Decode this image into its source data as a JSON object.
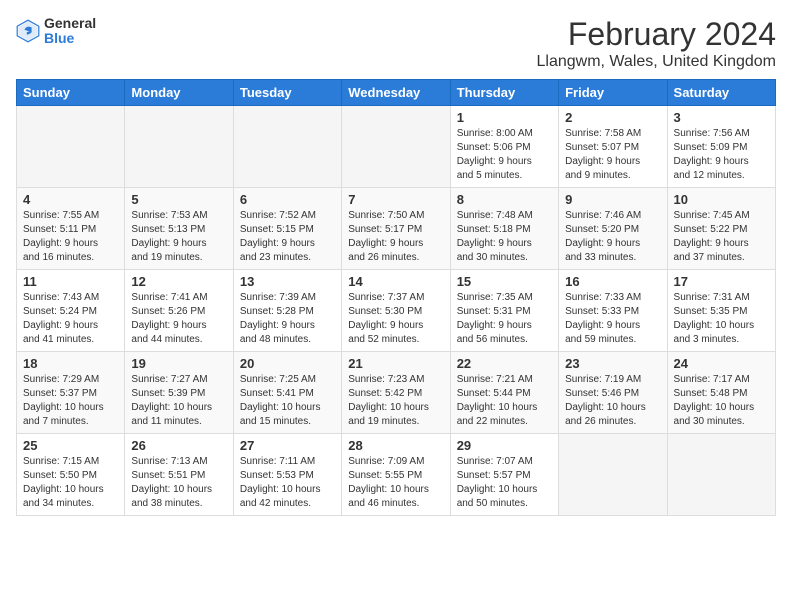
{
  "header": {
    "logo_general": "General",
    "logo_blue": "Blue",
    "title": "February 2024",
    "subtitle": "Llangwm, Wales, United Kingdom"
  },
  "days_of_week": [
    "Sunday",
    "Monday",
    "Tuesday",
    "Wednesday",
    "Thursday",
    "Friday",
    "Saturday"
  ],
  "weeks": [
    [
      {
        "day": "",
        "info": ""
      },
      {
        "day": "",
        "info": ""
      },
      {
        "day": "",
        "info": ""
      },
      {
        "day": "",
        "info": ""
      },
      {
        "day": "1",
        "info": "Sunrise: 8:00 AM\nSunset: 5:06 PM\nDaylight: 9 hours\nand 5 minutes."
      },
      {
        "day": "2",
        "info": "Sunrise: 7:58 AM\nSunset: 5:07 PM\nDaylight: 9 hours\nand 9 minutes."
      },
      {
        "day": "3",
        "info": "Sunrise: 7:56 AM\nSunset: 5:09 PM\nDaylight: 9 hours\nand 12 minutes."
      }
    ],
    [
      {
        "day": "4",
        "info": "Sunrise: 7:55 AM\nSunset: 5:11 PM\nDaylight: 9 hours\nand 16 minutes."
      },
      {
        "day": "5",
        "info": "Sunrise: 7:53 AM\nSunset: 5:13 PM\nDaylight: 9 hours\nand 19 minutes."
      },
      {
        "day": "6",
        "info": "Sunrise: 7:52 AM\nSunset: 5:15 PM\nDaylight: 9 hours\nand 23 minutes."
      },
      {
        "day": "7",
        "info": "Sunrise: 7:50 AM\nSunset: 5:17 PM\nDaylight: 9 hours\nand 26 minutes."
      },
      {
        "day": "8",
        "info": "Sunrise: 7:48 AM\nSunset: 5:18 PM\nDaylight: 9 hours\nand 30 minutes."
      },
      {
        "day": "9",
        "info": "Sunrise: 7:46 AM\nSunset: 5:20 PM\nDaylight: 9 hours\nand 33 minutes."
      },
      {
        "day": "10",
        "info": "Sunrise: 7:45 AM\nSunset: 5:22 PM\nDaylight: 9 hours\nand 37 minutes."
      }
    ],
    [
      {
        "day": "11",
        "info": "Sunrise: 7:43 AM\nSunset: 5:24 PM\nDaylight: 9 hours\nand 41 minutes."
      },
      {
        "day": "12",
        "info": "Sunrise: 7:41 AM\nSunset: 5:26 PM\nDaylight: 9 hours\nand 44 minutes."
      },
      {
        "day": "13",
        "info": "Sunrise: 7:39 AM\nSunset: 5:28 PM\nDaylight: 9 hours\nand 48 minutes."
      },
      {
        "day": "14",
        "info": "Sunrise: 7:37 AM\nSunset: 5:30 PM\nDaylight: 9 hours\nand 52 minutes."
      },
      {
        "day": "15",
        "info": "Sunrise: 7:35 AM\nSunset: 5:31 PM\nDaylight: 9 hours\nand 56 minutes."
      },
      {
        "day": "16",
        "info": "Sunrise: 7:33 AM\nSunset: 5:33 PM\nDaylight: 9 hours\nand 59 minutes."
      },
      {
        "day": "17",
        "info": "Sunrise: 7:31 AM\nSunset: 5:35 PM\nDaylight: 10 hours\nand 3 minutes."
      }
    ],
    [
      {
        "day": "18",
        "info": "Sunrise: 7:29 AM\nSunset: 5:37 PM\nDaylight: 10 hours\nand 7 minutes."
      },
      {
        "day": "19",
        "info": "Sunrise: 7:27 AM\nSunset: 5:39 PM\nDaylight: 10 hours\nand 11 minutes."
      },
      {
        "day": "20",
        "info": "Sunrise: 7:25 AM\nSunset: 5:41 PM\nDaylight: 10 hours\nand 15 minutes."
      },
      {
        "day": "21",
        "info": "Sunrise: 7:23 AM\nSunset: 5:42 PM\nDaylight: 10 hours\nand 19 minutes."
      },
      {
        "day": "22",
        "info": "Sunrise: 7:21 AM\nSunset: 5:44 PM\nDaylight: 10 hours\nand 22 minutes."
      },
      {
        "day": "23",
        "info": "Sunrise: 7:19 AM\nSunset: 5:46 PM\nDaylight: 10 hours\nand 26 minutes."
      },
      {
        "day": "24",
        "info": "Sunrise: 7:17 AM\nSunset: 5:48 PM\nDaylight: 10 hours\nand 30 minutes."
      }
    ],
    [
      {
        "day": "25",
        "info": "Sunrise: 7:15 AM\nSunset: 5:50 PM\nDaylight: 10 hours\nand 34 minutes."
      },
      {
        "day": "26",
        "info": "Sunrise: 7:13 AM\nSunset: 5:51 PM\nDaylight: 10 hours\nand 38 minutes."
      },
      {
        "day": "27",
        "info": "Sunrise: 7:11 AM\nSunset: 5:53 PM\nDaylight: 10 hours\nand 42 minutes."
      },
      {
        "day": "28",
        "info": "Sunrise: 7:09 AM\nSunset: 5:55 PM\nDaylight: 10 hours\nand 46 minutes."
      },
      {
        "day": "29",
        "info": "Sunrise: 7:07 AM\nSunset: 5:57 PM\nDaylight: 10 hours\nand 50 minutes."
      },
      {
        "day": "",
        "info": ""
      },
      {
        "day": "",
        "info": ""
      }
    ]
  ]
}
